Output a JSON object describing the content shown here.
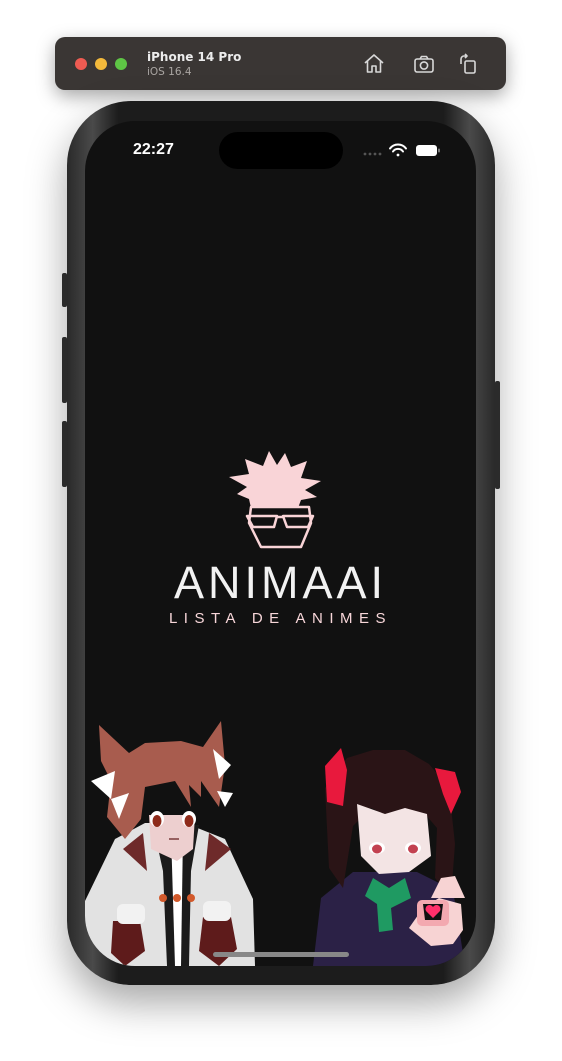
{
  "simulator": {
    "device_name": "iPhone 14 Pro",
    "os_version": "iOS 16.4",
    "buttons": [
      "home-icon",
      "screenshot-icon",
      "rotate-icon"
    ]
  },
  "status_bar": {
    "time": "22:27",
    "icons": [
      "cellular-icon",
      "wifi-icon",
      "battery-icon"
    ]
  },
  "splash": {
    "brand": "ANIMAAI",
    "tagline": "LISTA DE ANIMES",
    "accent_color": "#f9d4d7",
    "background_color": "#111111"
  }
}
